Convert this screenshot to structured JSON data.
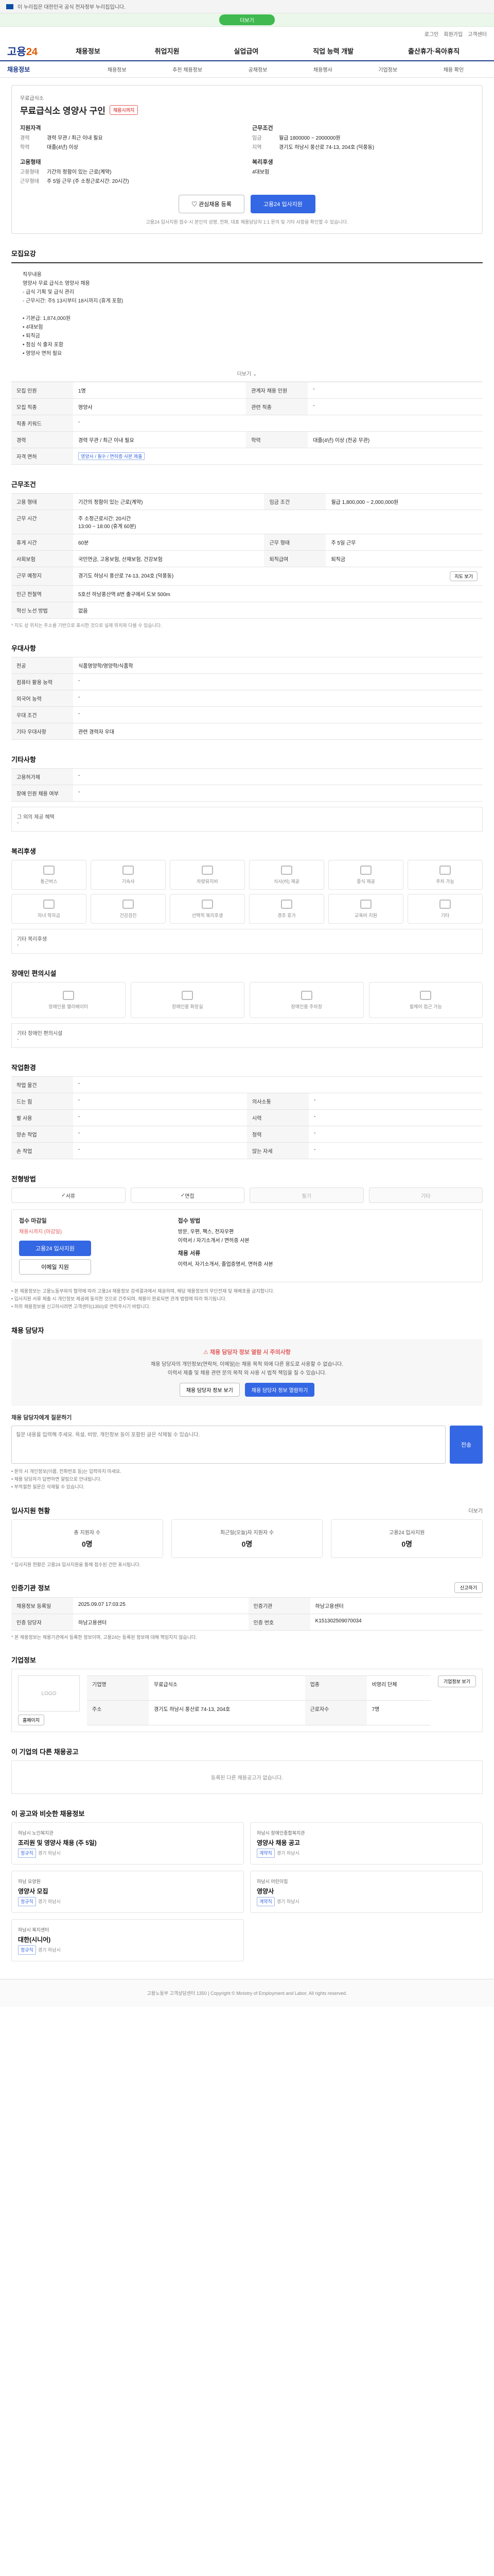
{
  "topbar": {
    "notice": "이 누리집은 대한민국 공식 전자정부 누리집입니다."
  },
  "banner": {
    "label": "더보기"
  },
  "util": [
    "로그인",
    "회원가입",
    "고객센터"
  ],
  "logo": {
    "main": "고용",
    "accent": "24"
  },
  "gnb": [
    "채용정보",
    "취업지원",
    "실업급여",
    "직업 능력 개발",
    "출산휴가·육아휴직"
  ],
  "subnav": {
    "title": "채용정보",
    "items": [
      "채용정보",
      "추천 채용정보",
      "공채정보",
      "채용행사",
      "기업정보",
      "채용 확인"
    ]
  },
  "job": {
    "title": "무료급식소 영양사 구인",
    "dday": "채용시까지",
    "company": "무료급식소",
    "qual_label": "지원자격",
    "qual": [
      {
        "k": "경력",
        "v": "경력 무관 / 최근 이내 필요"
      },
      {
        "k": "학력",
        "v": "대졸(4년) 이상"
      }
    ],
    "terms_label": "근무조건",
    "terms": [
      {
        "k": "임금",
        "v": "월급 1800000 ~ 2000000원"
      },
      {
        "k": "지역",
        "v": "경기도 하남시 풍산로 74-13, 204호 (덕풍동)"
      }
    ],
    "type_label": "고용형태",
    "type": [
      {
        "k": "고용형태",
        "v": "기간의 정함이 있는 근로(계약)"
      },
      {
        "k": "근무형태",
        "v": "주 5일 근무 (주 소정근로시간: 20시간)"
      }
    ],
    "welfare_label": "복리후생",
    "welfare": "4대보험",
    "scrap_btn": "관심채용 등록",
    "apply_btn": "고용24 입사지원",
    "notice": "고용24 입사지원 접수 시 본인의 성명, 전화, 대표 채용담당자 1:1 문의 및 기타 사항을 확인할 수 있습니다."
  },
  "recruit": {
    "heading": "모집요강",
    "desc": "직무내용\n영양사 무료 급식소 영양사 채용\n- 급식 기획 및 급식 관리\n- 근무시간: 주5 13시부터 18시까지 (휴게 포함)\n\n• 기본급: 1,874,000원\n• 4대보험\n• 퇴직금\n• 점심 식 출자 포함\n• 영양사 면허 필요",
    "more": "더보기",
    "rows": [
      {
        "k": "모집 인원",
        "v": "1명",
        "k2": "관계자 채용 인원",
        "v2": "-"
      },
      {
        "k": "모집 직종",
        "v": "영양사",
        "k2": "관련 직종",
        "v2": "-"
      },
      {
        "k": "직종 키워드",
        "v": "-",
        "k2": "",
        "v2": ""
      },
      {
        "k": "경력",
        "v": "경력 무관 / 최근 이내 필요",
        "k2": "학력",
        "v2": "대졸(4년) 이상 (전공 무관)"
      },
      {
        "k": "자격 면허",
        "v": "영양사 / 필수 / 면허증 사본 제출",
        "k2": "",
        "v2": ""
      }
    ]
  },
  "conditions": {
    "heading": "근무조건",
    "rows": [
      {
        "k": "고용 형태",
        "v": "기간의 정함이 있는 근로(계약)",
        "k2": "임금 조건",
        "v2": "월급 1,800,000 ~ 2,000,000원"
      },
      {
        "k": "근무 시간",
        "v": "주 소정근로시간: 20시간\n13:00 ~ 18:00 (휴게 60분)",
        "k2": "",
        "v2": ""
      },
      {
        "k": "휴게 시간",
        "v": "60분",
        "k2": "근무 형태",
        "v2": "주 5일 근무"
      },
      {
        "k": "사회보험",
        "v": "국민연금, 고용보험, 산재보험, 건강보험",
        "k2": "퇴직급여",
        "v2": "퇴직금"
      },
      {
        "k": "근무 예정지",
        "v": "경기도 하남시 풍산로 74-13, 204호 (덕풍동)",
        "k2": "",
        "v2": ""
      },
      {
        "k": "인근 전철역",
        "v": "5호선 하남풍산역 8번 출구에서 도보 500m",
        "k2": "",
        "v2": ""
      },
      {
        "k": "혁신 노선 방법",
        "v": "없음",
        "k2": "",
        "v2": ""
      }
    ],
    "map_btn": "지도 보기",
    "notice": "* 지도 상 위치는 주소를 기반으로 표시한 것으로 실제 위치와 다를 수 있습니다."
  },
  "welfare": {
    "heading": "우대사항",
    "rows": [
      {
        "k": "전공",
        "v": "식품영양학/영양학/식품학"
      },
      {
        "k": "컴퓨터 활용 능력",
        "v": "-"
      },
      {
        "k": "외국어 능력",
        "v": "-"
      },
      {
        "k": "우대 조건",
        "v": "-"
      },
      {
        "k": "기타 우대사항",
        "v": "관련 경력자 우대"
      }
    ]
  },
  "other": {
    "heading": "기타사항",
    "rows": [
      {
        "k": "고용허가제",
        "v": "-"
      },
      {
        "k": "장애 인원 채용 여부",
        "v": "-"
      }
    ],
    "extra_label": "그 외의 제공 혜택",
    "extra": "-"
  },
  "benefits": {
    "heading": "복리후생",
    "items": [
      "통근버스",
      "기숙사",
      "차량유지비",
      "식사(비) 제공",
      "중식 제공",
      "주차 가능",
      "자녀 학자금",
      "건강검진",
      "선택적 복리후생",
      "경조 휴가",
      "교육비 지원",
      "기타"
    ],
    "extra_label": "기타 복리후생",
    "extra": "-"
  },
  "disability": {
    "heading": "장애인 편의시설",
    "items": [
      "장애인용 엘리베이터",
      "장애인용 화장실",
      "장애인용 주차장",
      "휠체어 접근 가능"
    ],
    "extra_label": "기타 장애인 편의시설",
    "extra": "-"
  },
  "workenv": {
    "heading": "작업환경",
    "rows": [
      {
        "k": "작업 물건",
        "v": "-",
        "k2": "",
        "v2": ""
      },
      {
        "k": "드는 힘",
        "v": "-",
        "k2": "의사소통",
        "v2": "-"
      },
      {
        "k": "팔 사용",
        "v": "-",
        "k2": "시력",
        "v2": "-"
      },
      {
        "k": "양손 작업",
        "v": "-",
        "k2": "청력",
        "v2": "-"
      },
      {
        "k": "손 작업",
        "v": "-",
        "k2": "앉는 자세",
        "v2": "-"
      }
    ]
  },
  "process": {
    "heading": "전형방법",
    "methods": [
      {
        "label": "서류",
        "on": true
      },
      {
        "label": "면접",
        "on": true
      },
      {
        "label": "필기",
        "on": false
      },
      {
        "label": "기타",
        "on": false
      }
    ]
  },
  "apply": {
    "period_label": "접수 마감일",
    "period": "채용시까지 (마감일)",
    "apply_btn": "고용24 입사지원",
    "email_btn": "이메일 지원",
    "docs_label": "접수 방법",
    "docs": "방문, 우편, 팩스, 전자우편\n이력서 / 자기소개서 / 면허증 사본",
    "contact_label": "채용 서류",
    "contact": "이력서, 자기소개서, 졸업증명서, 면허증 사본",
    "notes": [
      "• 본 채용정보는 고용노동부와의 협약에 따라 고용24 채용정보 검색결과에서 제공하며, 해당 채용정보의 무단전재 및 재배포를 금지합니다.",
      "• 입사지원 서류 제출 시 개인정보 제공에 동의한 것으로 간주되며, 채용이 완료되면 관계 법령에 따라 파기됩니다.",
      "• 허위 채용정보를 신고하시려면 고객센터(1350)로 연락주시기 바랍니다."
    ]
  },
  "manager": {
    "heading": "채용 담당자",
    "alert_title": "채용 담당자 정보 열람 시 주의사항",
    "alert_text": "채용 담당자의 개인정보(연락처, 이메일)는 채용 목적 외에 다른 용도로 사용할 수 없습니다.\n이력서 제출 및 채용 관련 문의 목적 외 사용 시 법적 책임을 질 수 있습니다.",
    "btn1": "채용 담당자 정보 보기",
    "btn2": "채용 담당자 정보 열람하기",
    "q_label": "채용 담당자에게 질문하기",
    "q_placeholder": "질문 내용을 입력해 주세요. 욕설, 비방, 개인정보 등이 포함된 글은 삭제될 수 있습니다.",
    "q_btn": "전송",
    "notices": [
      "• 문의 시 개인정보(이름, 전화번호 등)는 입력하지 마세요.",
      "• 채용 담당자가 답변하면 알림으로 안내됩니다.",
      "• 부적절한 질문은 삭제될 수 있습니다."
    ]
  },
  "stats": {
    "heading": "입사지원 현황",
    "more": "더보기",
    "items": [
      {
        "label": "총 지원자 수",
        "value": "0명"
      },
      {
        "label": "최근일(오늘)자 지원자 수",
        "value": "0명"
      },
      {
        "label": "고용24 입사지원",
        "value": "0명"
      }
    ],
    "notice": "* 입사지원 현황은 고용24 입사지원을 통해 접수된 건만 표시됩니다."
  },
  "info": {
    "heading": "인증기관 정보",
    "btn": "신고하기",
    "rows": [
      {
        "k": "채용정보 등록일",
        "v": "2025.09.07 17:03:25",
        "k2": "인증기관",
        "v2": "하남고용센터"
      },
      {
        "k": "인증 담당자",
        "v": "하남고용센터",
        "k2": "인증 번호",
        "v2": "K151302509070034"
      }
    ],
    "notice": "* 본 채용정보는 채용기관에서 등록한 정보이며, 고용24는 등록된 정보에 대해 책임지지 않습니다."
  },
  "company": {
    "heading": "기업정보",
    "logo": "LOGO",
    "btn_home": "홈페이지",
    "btn_more": "기업정보 보기",
    "rows": [
      {
        "k": "기업명",
        "v": "무료급식소",
        "k2": "업종",
        "v2": "비영리 단체"
      },
      {
        "k": "주소",
        "v": "경기도 하남시 풍산로 74-13, 204호",
        "k2": "근로자수",
        "v2": "7명"
      }
    ]
  },
  "other_jobs": {
    "heading": "이 기업의 다른 채용공고",
    "empty": "등록된 다른 채용공고가 없습니다."
  },
  "recommend": {
    "heading": "이 공고와 비슷한 채용정보",
    "cards": [
      {
        "company": "하남시 노인복지관",
        "title": "조리원 및 영양사 채용 (주 5일)",
        "loc": "경기 하남시",
        "tag": "정규직"
      },
      {
        "company": "하남시 장애인종합복지관",
        "title": "영양사 채용 공고",
        "loc": "경기 하남시",
        "tag": "계약직"
      },
      {
        "company": "하남 요양원",
        "title": "영양사 모집",
        "loc": "경기 하남시",
        "tag": "정규직"
      },
      {
        "company": "하남시 어린이집",
        "title": "영양사",
        "loc": "경기 하남시",
        "tag": "계약직"
      },
      {
        "company": "하남시 복지센터",
        "title": "대한(시니어)",
        "loc": "경기 하남시",
        "tag": "정규직"
      }
    ]
  },
  "footer": {
    "text": "고용노동부 고객상담센터 1350 | Copyright © Ministry of Employment and Labor. All rights reserved."
  }
}
